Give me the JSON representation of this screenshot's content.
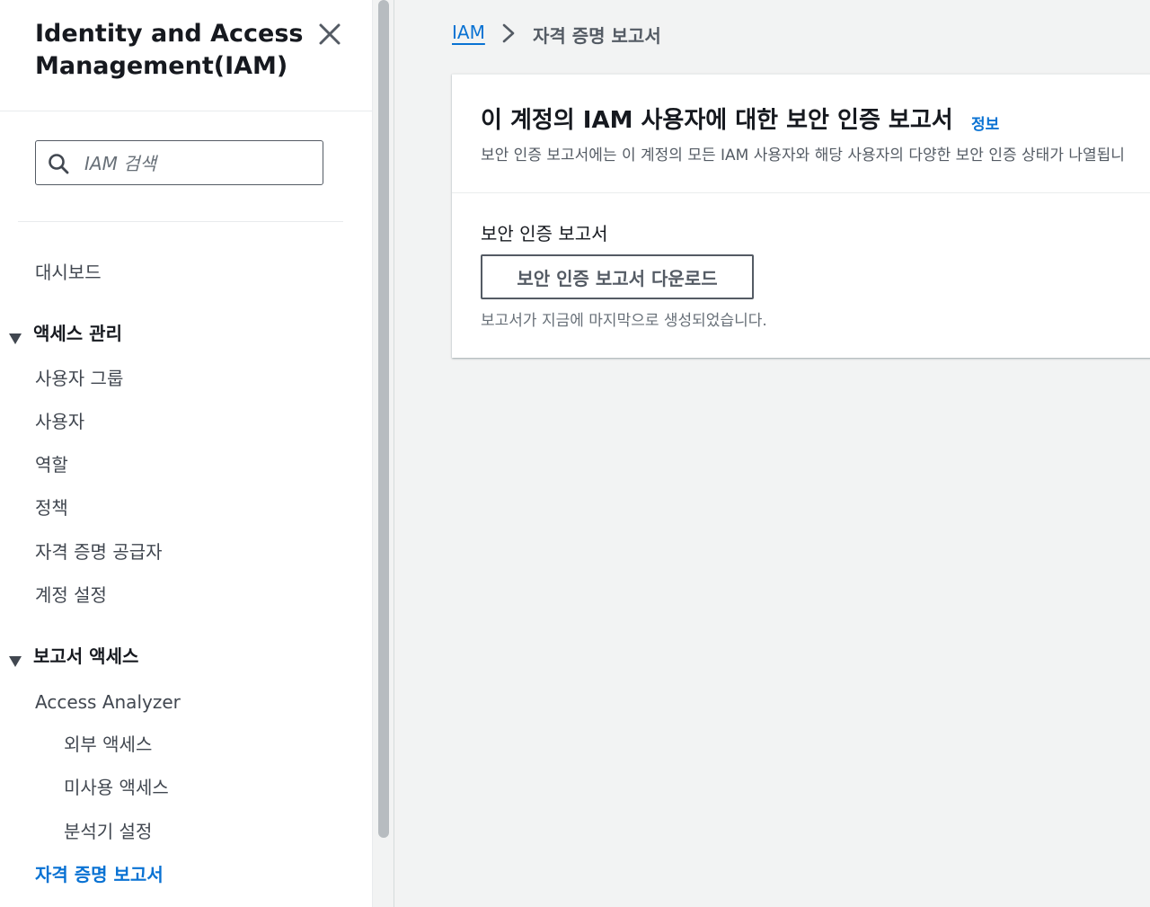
{
  "sidebar": {
    "title": "Identity and Access Management(IAM)",
    "search_placeholder": "IAM 검색",
    "dashboard": "대시보드",
    "access_management": {
      "label": "액세스 관리",
      "items": [
        "사용자 그룹",
        "사용자",
        "역할",
        "정책",
        "자격 증명 공급자",
        "계정 설정"
      ]
    },
    "access_reports": {
      "label": "보고서 액세스",
      "analyzer": "Access Analyzer",
      "analyzer_items": [
        "외부 액세스",
        "미사용 액세스",
        "분석기 설정"
      ],
      "credential_report": "자격 증명 보고서"
    }
  },
  "breadcrumb": {
    "root": "IAM",
    "current": "자격 증명 보고서"
  },
  "card": {
    "title": "이 계정의 IAM 사용자에 대한 보안 인증 보고서",
    "info_link": "정보",
    "description": "보안 인증 보고서에는 이 계정의 모든 IAM 사용자와 해당 사용자의 다양한 보안 인증 상태가 나열됩니",
    "field_label": "보안 인증 보고서",
    "download_button": "보안 인증 보고서 다운로드",
    "help_text": "보고서가 지금에 마지막으로 생성되었습니다."
  },
  "colors": {
    "link": "#0972d3",
    "background": "#f2f3f3",
    "text": "#16191f"
  }
}
